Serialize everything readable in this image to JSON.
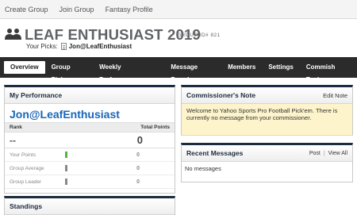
{
  "topbar": {
    "links": [
      "Create Group",
      "Join Group",
      "Fantasy Profile"
    ]
  },
  "header": {
    "title": "LEAF ENTHUSIAST 2019",
    "group_id": "GROUP ID# 821",
    "picks_label": "Your Picks:",
    "picks_value": "Jon@LeafEnthusiast"
  },
  "nav": {
    "tabs": [
      "Overview",
      "Group Picks",
      "Weekly Performance",
      "Message Board",
      "Members",
      "Settings",
      "Commish Tools"
    ],
    "active": "Overview"
  },
  "performance": {
    "title": "My Performance",
    "team": "Jon@LeafEnthusiast",
    "col_rank": "Rank",
    "col_points": "Total Points",
    "rank": "--",
    "total_points": "0",
    "rows": [
      {
        "label": "Your Points",
        "value": "0",
        "color": "#53b43f"
      },
      {
        "label": "Group Average",
        "value": "0",
        "color": "#888888"
      },
      {
        "label": "Group Leader",
        "value": "0",
        "color": "#888888"
      }
    ]
  },
  "standings": {
    "title": "Standings"
  },
  "commissioner": {
    "title": "Commissioner's Note",
    "edit_label": "Edit Note",
    "body": "Welcome to Yahoo Sports Pro Football Pick'em. There is currently no message from your commissioner."
  },
  "recent": {
    "title": "Recent Messages",
    "post_label": "Post",
    "separator": "|",
    "view_all_label": "View All",
    "empty": "No messages"
  },
  "colors": {
    "nav_bg": "#2b2b2b",
    "team_link": "#1a66b7",
    "note_bg": "#fdf4cc",
    "panel_accent": "#1c2b3f"
  }
}
